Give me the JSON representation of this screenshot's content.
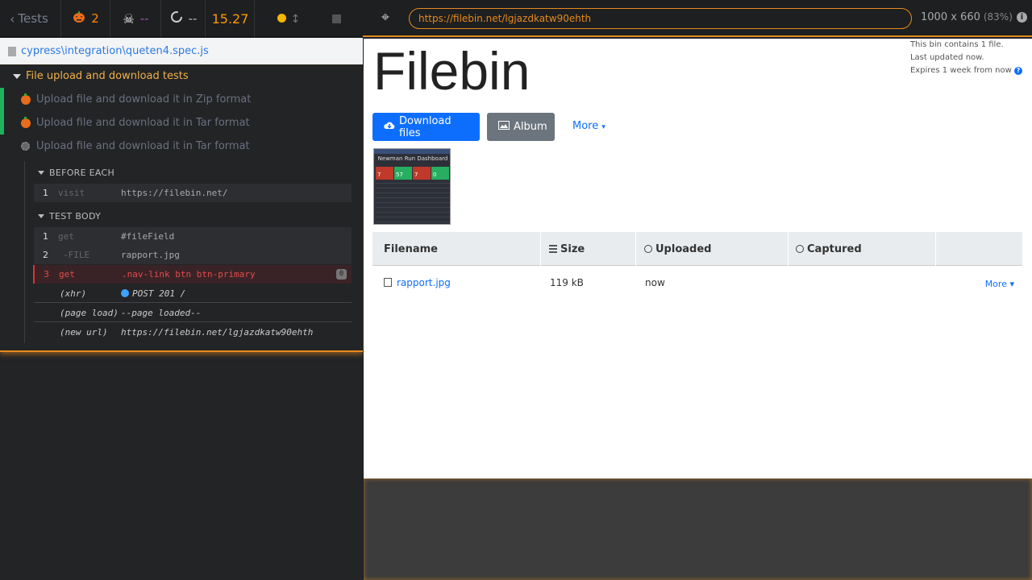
{
  "stats": {
    "back_label": "Tests",
    "failed_count": "2",
    "pending_count": "--",
    "running_count": "--",
    "duration": "15.27"
  },
  "spec": {
    "path": "cypress\\integration\\queten4.spec.js"
  },
  "suite": {
    "title": "File upload and download tests",
    "tests": [
      {
        "title": "Upload file and download it in Zip format",
        "state": "failed"
      },
      {
        "title": "Upload file and download it in Tar format",
        "state": "failed"
      },
      {
        "title": "Upload file and download it in Tar format",
        "state": "running"
      }
    ],
    "before_each": {
      "label": "BEFORE EACH",
      "commands": [
        {
          "num": "1",
          "name": "visit",
          "message": "https://filebin.net/"
        }
      ]
    },
    "test_body": {
      "label": "TEST BODY",
      "commands": [
        {
          "num": "1",
          "name": "get",
          "message": "#fileField"
        },
        {
          "num": "2",
          "name": "-FILE",
          "message": "rapport.jpg"
        },
        {
          "num": "3",
          "name": "get",
          "message": ".nav-link btn btn-primary",
          "badge": "0"
        }
      ],
      "events": [
        {
          "name": "(xhr)",
          "message": "POST 201 /"
        },
        {
          "name": "(page load)",
          "message": "--page loaded--"
        },
        {
          "name": "(new url)",
          "message": "https://filebin.net/lgjazdkatw90ehth"
        }
      ]
    }
  },
  "aut_header": {
    "url": "https://filebin.net/lgjazdkatw90ehth",
    "viewport": "1000 x 660",
    "scale": "(83%)"
  },
  "filebin": {
    "title": "Filebin",
    "info": [
      "This bin contains 1 file.",
      "Last updated now.",
      "Expires 1 week from now"
    ],
    "download_label": "Download files",
    "album_label": "Album",
    "more_label": "More",
    "thumbnail": {
      "title": "Newman Run Dashboard",
      "values": [
        "7",
        "57",
        "7",
        "0"
      ]
    },
    "table": {
      "headers": [
        "Filename",
        "Size",
        "Uploaded",
        "Captured"
      ],
      "rows": [
        {
          "filename": "rapport.jpg",
          "size": "119 kB",
          "uploaded": "now",
          "captured": "",
          "more": "More"
        }
      ]
    }
  },
  "colors": {
    "accent_orange": "#e68a1d",
    "primary_blue": "#0d6efd",
    "failed_orange": "#ff8800",
    "error_red": "#e04c4c"
  }
}
